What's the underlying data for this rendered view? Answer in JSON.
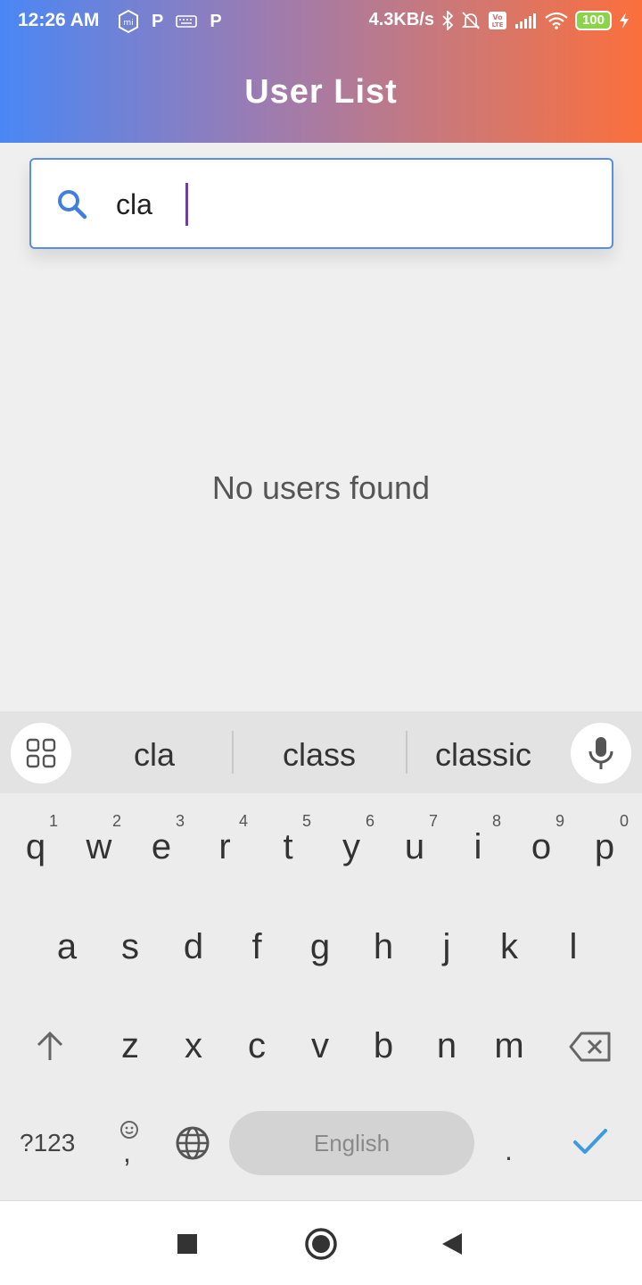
{
  "status_bar": {
    "time": "12:26 AM",
    "left_icons": [
      "mi-icon",
      "p-icon",
      "keyboard-icon",
      "p-icon"
    ],
    "network_speed": "4.3KB/s",
    "battery": "100",
    "right_icons": [
      "bluetooth-icon",
      "mute-icon",
      "volte-icon",
      "signal-icon",
      "wifi-icon",
      "battery-icon",
      "charging-icon"
    ]
  },
  "header": {
    "title": "User List"
  },
  "search": {
    "value": "cla",
    "icon": "search-icon"
  },
  "main": {
    "empty_message": "No users found"
  },
  "keyboard": {
    "suggestions": [
      "cla",
      "class",
      "classic"
    ],
    "row1": [
      "q",
      "w",
      "e",
      "r",
      "t",
      "y",
      "u",
      "i",
      "o",
      "p"
    ],
    "row1_numbers": [
      "1",
      "2",
      "3",
      "4",
      "5",
      "6",
      "7",
      "8",
      "9",
      "0"
    ],
    "row2": [
      "a",
      "s",
      "d",
      "f",
      "g",
      "h",
      "j",
      "k",
      "l"
    ],
    "row3": [
      "z",
      "x",
      "c",
      "v",
      "b",
      "n",
      "m"
    ],
    "symbols_key": "?123",
    "comma_key": ",",
    "space_label": "English",
    "period_key": ".",
    "accent_color": "#3b9be0"
  },
  "colors": {
    "header_start": "#4a87f5",
    "header_end": "#fb6f3c",
    "search_border": "#5a8fe0"
  }
}
